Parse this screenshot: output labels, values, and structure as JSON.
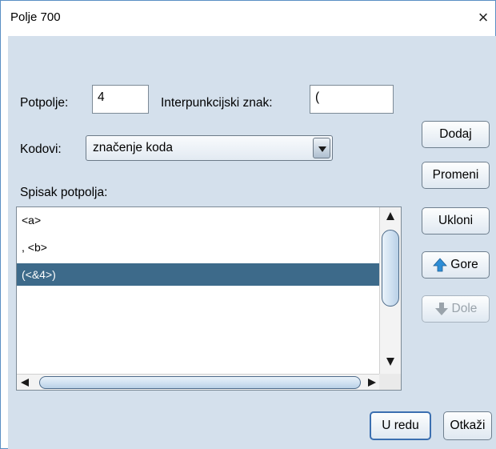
{
  "window": {
    "title": "Polje 700",
    "close_label": "×"
  },
  "form": {
    "subfield_label": "Potpolje:",
    "subfield_value": "4",
    "punct_label": "Interpunkcijski znak:",
    "punct_value": "(",
    "codes_label": "Kodovi:",
    "codes_selected": "značenje koda",
    "list_label": "Spisak potpolja:"
  },
  "list": {
    "items": [
      "<a>",
      ", <b>",
      "(<&4>)"
    ],
    "selected_index": 2
  },
  "side_buttons": {
    "add": "Dodaj",
    "change": "Promeni",
    "remove": "Ukloni",
    "up": "Gore",
    "down": "Dole"
  },
  "footer": {
    "ok": "U redu",
    "cancel": "Otkaži"
  },
  "icons": {
    "up": "arrow-up-icon",
    "down": "arrow-down-icon",
    "close": "close-icon"
  },
  "colors": {
    "selection": "#3d6a8a",
    "panel": "#d4e0ec",
    "up_arrow": "#2e8ed6",
    "down_arrow": "#9aa3ab"
  }
}
